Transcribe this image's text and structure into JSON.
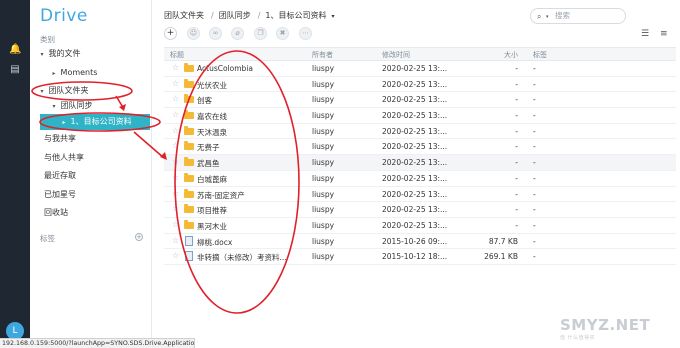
{
  "app": {
    "name": "Drive"
  },
  "rail": {
    "icons": [
      "bell-icon",
      "document-icon"
    ],
    "avatar_initial": "L"
  },
  "sidebar": {
    "category_label": "类别",
    "tags_label": "标签",
    "items": [
      {
        "label": "我的文件",
        "caret": "▾"
      },
      {
        "label": "Moments",
        "caret": "▸"
      },
      {
        "label": "团队文件夹",
        "caret": "▾"
      },
      {
        "label": "团队同步",
        "caret": "▾"
      },
      {
        "label": "1、目标公司资料",
        "caret": "▸"
      },
      {
        "label": "与我共享",
        "caret": ""
      },
      {
        "label": "与他人共享",
        "caret": ""
      },
      {
        "label": "最近存取",
        "caret": ""
      },
      {
        "label": "已加星号",
        "caret": ""
      },
      {
        "label": "回收站",
        "caret": ""
      }
    ]
  },
  "breadcrumb": {
    "parts": [
      "团队文件夹",
      "团队同步",
      "1、目标公司资料"
    ],
    "separator": "/",
    "caret": "▾"
  },
  "search": {
    "placeholder": "搜索"
  },
  "toolbar": {
    "new_label": "+"
  },
  "table": {
    "headers": {
      "name": "标题",
      "owner": "所有者",
      "modified": "修改时间",
      "size": "大小",
      "tags": "标签"
    },
    "rows": [
      {
        "type": "folder",
        "name": "ActusColombia",
        "owner": "liuspy",
        "modified": "2020-02-25 13:...",
        "size": "-",
        "tags": "-"
      },
      {
        "type": "folder",
        "name": "光伏农业",
        "owner": "liuspy",
        "modified": "2020-02-25 13:...",
        "size": "-",
        "tags": "-"
      },
      {
        "type": "folder",
        "name": "创客",
        "owner": "liuspy",
        "modified": "2020-02-25 13:...",
        "size": "-",
        "tags": "-"
      },
      {
        "type": "folder",
        "name": "嘉农在线",
        "owner": "liuspy",
        "modified": "2020-02-25 13:...",
        "size": "-",
        "tags": "-"
      },
      {
        "type": "folder",
        "name": "天沐温泉",
        "owner": "liuspy",
        "modified": "2020-02-25 13:...",
        "size": "-",
        "tags": "-"
      },
      {
        "type": "folder",
        "name": "无费子",
        "owner": "liuspy",
        "modified": "2020-02-25 13:...",
        "size": "-",
        "tags": "-"
      },
      {
        "type": "folder",
        "name": "武昌鱼",
        "owner": "liuspy",
        "modified": "2020-02-25 13:...",
        "size": "-",
        "tags": "-"
      },
      {
        "type": "folder",
        "name": "白城蓖麻",
        "owner": "liuspy",
        "modified": "2020-02-25 13:...",
        "size": "-",
        "tags": "-"
      },
      {
        "type": "folder",
        "name": "苏南-固定资产",
        "owner": "liuspy",
        "modified": "2020-02-25 13:...",
        "size": "-",
        "tags": "-"
      },
      {
        "type": "folder",
        "name": "项目推荐",
        "owner": "liuspy",
        "modified": "2020-02-25 13:...",
        "size": "-",
        "tags": "-"
      },
      {
        "type": "folder",
        "name": "黑河木业",
        "owner": "liuspy",
        "modified": "2020-02-25 13:...",
        "size": "-",
        "tags": "-"
      },
      {
        "type": "doc",
        "name": "柳桃.docx",
        "owner": "liuspy",
        "modified": "2015-10-26 09:...",
        "size": "87.7 KB",
        "tags": "-"
      },
      {
        "type": "doc",
        "name": "非转摘（未修改）考资料...",
        "owner": "liuspy",
        "modified": "2015-10-12 18:...",
        "size": "269.1 KB",
        "tags": "-"
      }
    ]
  },
  "statusbar": {
    "url": "192.168.0.159:5000/?launchApp=SYNO.SDS.Drive.Application#"
  },
  "watermark": {
    "text": "SMYZ.NET",
    "sub": "值 什么值得买"
  },
  "colors": {
    "accent": "#3fa7e0",
    "active_bg": "#2fb3c6",
    "folder": "#f5b935",
    "annotation": "#e0202a"
  }
}
